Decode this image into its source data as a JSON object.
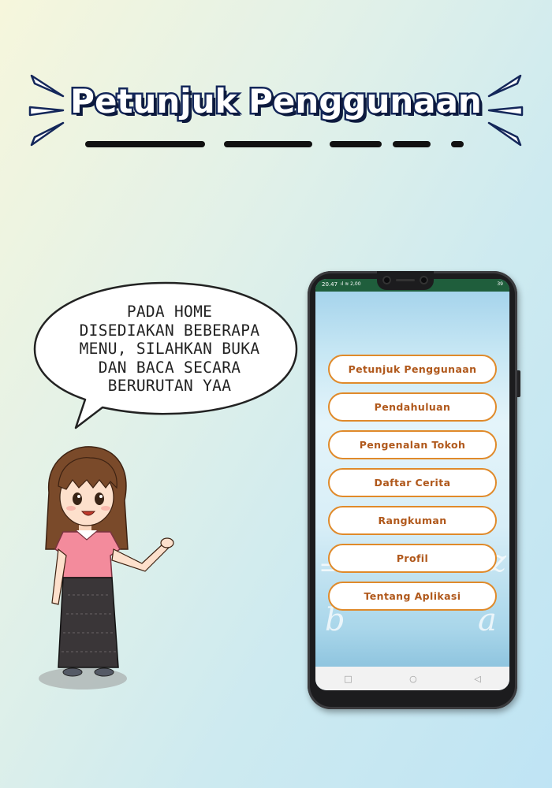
{
  "title": "Petunjuk Penggunaan",
  "speech": {
    "text": "PADA HOME\nDISEDIAKAN BEBERAPA\nMENU, SILAHKAN BUKA\nDAN BACA SECARA\nBERURUTAN YAA"
  },
  "phone": {
    "status_time": "20.47",
    "status_signal": "ıl ≋ 2,00",
    "status_battery": "39",
    "menu_items": [
      "Petunjuk Penggunaan",
      "Pendahuluan",
      "Pengenalan Tokoh",
      "Daftar Cerita",
      "Rangkuman",
      "Profil",
      "Tentang Aplikasi"
    ],
    "nav": {
      "recent": "□",
      "home": "○",
      "back": "◁"
    }
  },
  "colors": {
    "title_outline": "#14275a",
    "button_border": "#e08a2a",
    "button_text": "#b0581b",
    "status_bar": "#1f5e3c"
  }
}
